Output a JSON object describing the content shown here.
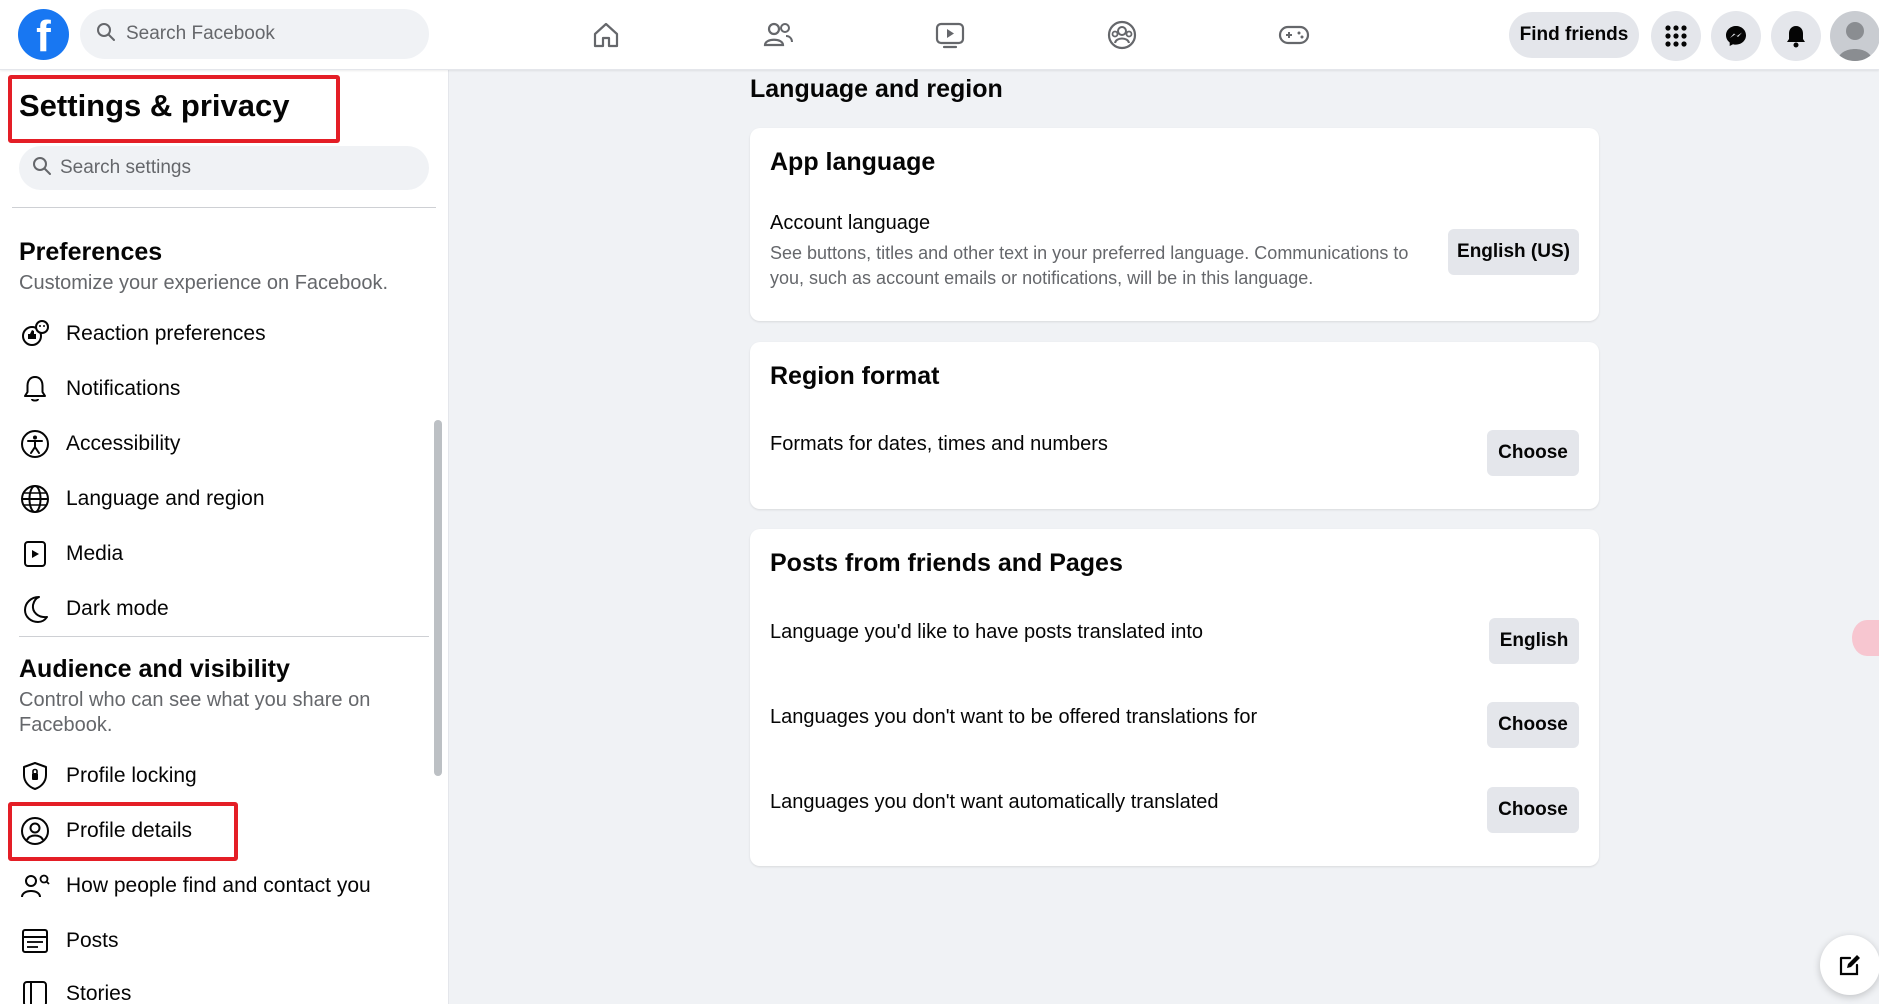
{
  "topbar": {
    "logo": "f",
    "search_placeholder": "Search Facebook",
    "find_friends_label": "Find friends"
  },
  "sidebar": {
    "title": "Settings & privacy",
    "search_placeholder": "Search settings",
    "preferences": {
      "title": "Preferences",
      "subtitle": "Customize your experience on Facebook.",
      "items": [
        {
          "label": "Reaction preferences",
          "icon": "reaction-icon"
        },
        {
          "label": "Notifications",
          "icon": "bell-icon"
        },
        {
          "label": "Accessibility",
          "icon": "accessibility-icon"
        },
        {
          "label": "Language and region",
          "icon": "globe-icon"
        },
        {
          "label": "Media",
          "icon": "media-icon"
        },
        {
          "label": "Dark mode",
          "icon": "moon-icon"
        }
      ]
    },
    "audience": {
      "title": "Audience and visibility",
      "subtitle": "Control who can see what you share on Facebook.",
      "items": [
        {
          "label": "Profile locking",
          "icon": "shield-icon"
        },
        {
          "label": "Profile details",
          "icon": "person-circle-icon"
        },
        {
          "label": "How people find and contact you",
          "icon": "people-search-icon"
        },
        {
          "label": "Posts",
          "icon": "posts-icon"
        },
        {
          "label": "Stories",
          "icon": "stories-icon"
        }
      ]
    }
  },
  "main": {
    "title": "Language and region",
    "app_language": {
      "title": "App language",
      "account_label": "Account language",
      "account_desc": "See buttons, titles and other text in your preferred language. Communications to you, such as account emails or notifications, will be in this language.",
      "account_button": "English (US)"
    },
    "region_format": {
      "title": "Region format",
      "label": "Formats for dates, times and numbers",
      "button": "Choose"
    },
    "posts_translation": {
      "title": "Posts from friends and Pages",
      "rows": [
        {
          "label": "Language you'd like to have posts translated into",
          "button": "English"
        },
        {
          "label": "Languages you don't want to be offered translations for",
          "button": "Choose"
        },
        {
          "label": "Languages you don't want automatically translated",
          "button": "Choose"
        }
      ]
    }
  },
  "colors": {
    "brand": "#1877f2",
    "highlight": "#e41e26",
    "background": "#f0f2f5"
  }
}
